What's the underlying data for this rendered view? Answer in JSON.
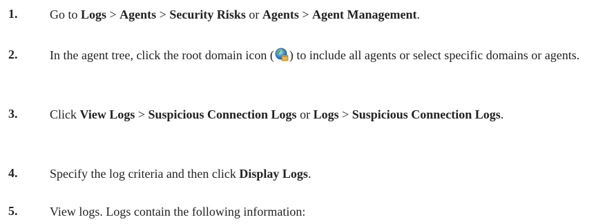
{
  "steps": [
    {
      "number": "1.",
      "parts": [
        {
          "t": "Go to "
        },
        {
          "t": "Logs",
          "b": true
        },
        {
          "t": " > "
        },
        {
          "t": "Agents",
          "b": true
        },
        {
          "t": " > "
        },
        {
          "t": "Security Risks",
          "b": true
        },
        {
          "t": " or "
        },
        {
          "t": "Agents",
          "b": true
        },
        {
          "t": " > "
        },
        {
          "t": "Agent Management",
          "b": true
        },
        {
          "t": "."
        }
      ]
    },
    {
      "number": "2.",
      "parts": [
        {
          "t": "In the agent tree, click the root domain icon ("
        },
        {
          "icon": "root-domain-globe-icon"
        },
        {
          "t": ") to include all agents or select specific domains or agents."
        }
      ]
    },
    {
      "number": "3.",
      "parts": [
        {
          "t": "Click "
        },
        {
          "t": "View Logs",
          "b": true
        },
        {
          "t": " > "
        },
        {
          "t": "Suspicious Connection Logs",
          "b": true
        },
        {
          "t": " or "
        },
        {
          "t": "Logs",
          "b": true
        },
        {
          "t": " > "
        },
        {
          "t": "Suspicious Connection Logs",
          "b": true
        },
        {
          "t": "."
        }
      ]
    },
    {
      "number": "4.",
      "parts": [
        {
          "t": "Specify the log criteria and then click "
        },
        {
          "t": "Display Logs",
          "b": true
        },
        {
          "t": "."
        }
      ]
    },
    {
      "number": "5.",
      "parts": [
        {
          "t": "View logs. Logs contain the following information:"
        }
      ]
    }
  ]
}
